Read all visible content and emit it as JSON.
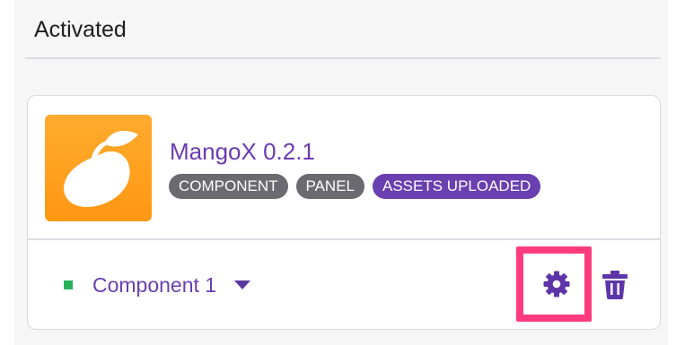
{
  "section": {
    "title": "Activated"
  },
  "plugin": {
    "name": "MangoX 0.2.1",
    "logo_icon": "mango-logo-icon",
    "tags": [
      {
        "label": "COMPONENT",
        "style": "grey"
      },
      {
        "label": "PANEL",
        "style": "grey"
      },
      {
        "label": "ASSETS UPLOADED",
        "style": "purple"
      }
    ]
  },
  "component_select": {
    "selected": "Component 1",
    "status": "active",
    "status_color": "#27b15a"
  },
  "actions": {
    "settings_icon": "gear-icon",
    "delete_icon": "trash-icon"
  },
  "colors": {
    "accent": "#6a3fb0",
    "highlight": "#ff3b7e",
    "logo": "#ff9f1c"
  }
}
